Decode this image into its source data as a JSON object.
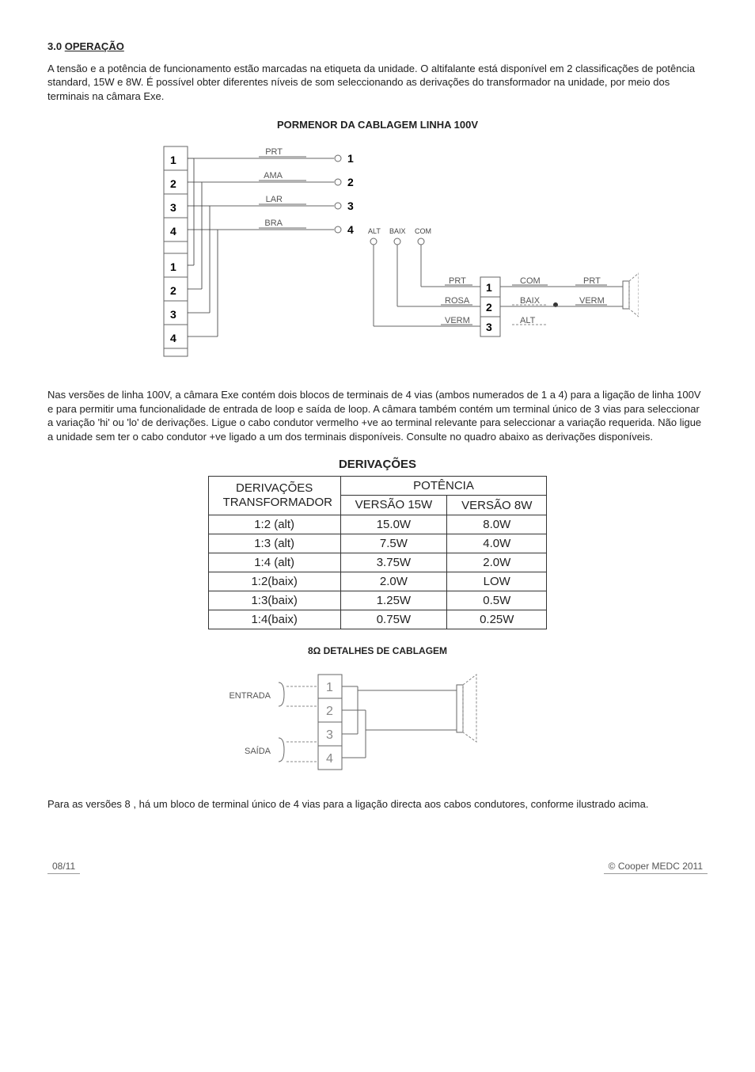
{
  "section": {
    "num": "3.0",
    "title": "OPERAÇÃO"
  },
  "p1": "A tensão e a potência de funcionamento estão marcadas na etiqueta da unidade. O altifalante está disponível em 2 classificações de potência standard, 15W e 8W. É possível obter diferentes níveis de som seleccionando as derivações do transformador na unidade, por meio dos terminais na câmara Exe.",
  "diag1_title": "PORMENOR DA CABLAGEM LINHA 100V",
  "wires_left": {
    "w1": "PRT",
    "w2": "AMA",
    "w3": "LAR",
    "w4": "BRA"
  },
  "labels_small": {
    "alt": "ALT",
    "baix": "BAIX",
    "com": "COM"
  },
  "wires_mid": {
    "w1": "PRT",
    "w2": "ROSA",
    "w3": "VERM"
  },
  "wires_right": {
    "top": "COM",
    "mid": "BAIX",
    "bot": "ALT",
    "rtop": "PRT",
    "rmid": "VERM"
  },
  "block_nums": {
    "n1": "1",
    "n2": "2",
    "n3": "3",
    "n4": "4"
  },
  "p2": "Nas versões de linha 100V, a câmara Exe contém dois blocos de terminais de 4 vias (ambos numerados de 1 a 4) para a ligação de linha 100V e para permitir uma funcionalidade de entrada de loop e saída de loop. A câmara também contém um terminal único de 3 vias para seleccionar a variação 'hi' ou 'lo' de derivações. Ligue o cabo condutor vermelho +ve ao terminal relevante para seleccionar a variação requerida. Não ligue a unidade sem ter o cabo condutor +ve ligado a um dos terminais disponíveis. Consulte no quadro abaixo as derivações disponíveis.",
  "table_title": "DERIVAÇÕES",
  "thead": {
    "c1": "DERIVAÇÕES TRANSFORMADOR",
    "c2": "POTÊNCIA",
    "c2a": "VERSÃO 15W",
    "c2b": "VERSÃO 8W"
  },
  "rows": [
    {
      "a": "1:2 (alt)",
      "b": "15.0W",
      "c": "8.0W"
    },
    {
      "a": "1:3 (alt)",
      "b": "7.5W",
      "c": "4.0W"
    },
    {
      "a": "1:4 (alt)",
      "b": "3.75W",
      "c": "2.0W"
    },
    {
      "a": "1:2(baix)",
      "b": "2.0W",
      "c": "LOW"
    },
    {
      "a": "1:3(baix)",
      "b": "1.25W",
      "c": "0.5W"
    },
    {
      "a": "1:4(baix)",
      "b": "0.75W",
      "c": "0.25W"
    }
  ],
  "diag2_title": "8Ω DETALHES DE CABLAGEM",
  "io": {
    "in": "ENTRADA",
    "out": "SAÍDA"
  },
  "p3": "Para as versões 8 , há um bloco de terminal único de 4 vias para a ligação directa aos cabos condutores, conforme ilustrado acima.",
  "footer": {
    "left": "08/11",
    "right": "© Cooper MEDC 2011"
  }
}
